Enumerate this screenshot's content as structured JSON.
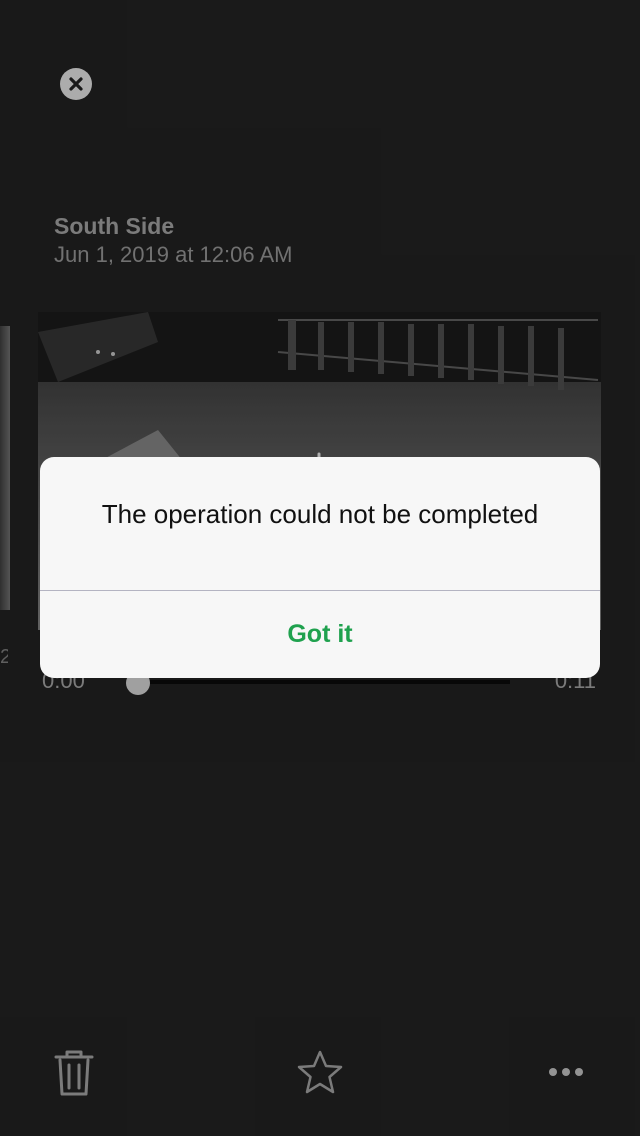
{
  "header": {
    "camera_name": "South Side",
    "event_time": "Jun 1, 2019 at 12:06 AM"
  },
  "icons": {
    "close": "close-icon",
    "trash": "trash-icon",
    "star": "star-icon",
    "more": "more-icon",
    "spinner": "loading-spinner-icon"
  },
  "player": {
    "current_time": "0:00",
    "duration": "0:11",
    "progress": 0,
    "previous_clip_label": "2"
  },
  "dialog": {
    "message": "The operation could not be completed",
    "button_label": "Got it"
  },
  "colors": {
    "background": "#202020",
    "accent": "#1fa14e",
    "dialog_background": "#f7f7f7"
  }
}
